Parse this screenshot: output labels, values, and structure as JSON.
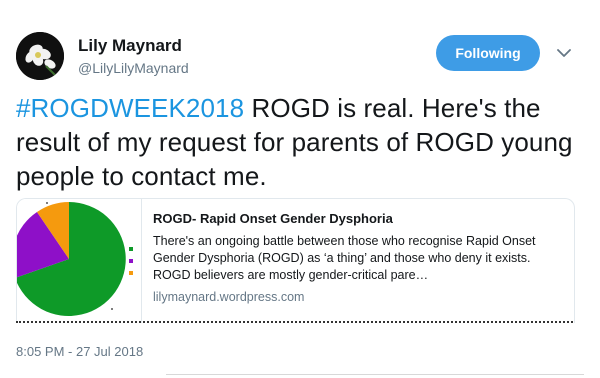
{
  "author": {
    "name": "Lily Maynard",
    "handle": "@LilyLilyMaynard"
  },
  "follow_button": {
    "label": "Following",
    "color": "#3e9ce6"
  },
  "tweet": {
    "hashtag": "#ROGDWEEK2018",
    "text": " ROGD is real. Here's the result of my request for parents of ROGD young people to contact me."
  },
  "card": {
    "title": "ROGD- Rapid Onset Gender Dysphoria",
    "description": "There's an ongoing battle between those who recognise Rapid Onset Gender Dysphoria (ROGD) as ‘a thing’ and those who deny it exists. ROGD believers are mostly gender-critical pare…",
    "url": "lilymaynard.wordpress.com",
    "image": {
      "type": "pie",
      "colors": [
        "#0e9a28",
        "#8e10c8",
        "#f59a0e"
      ]
    }
  },
  "timestamp": "8:05 PM - 27 Jul 2018",
  "colors": {
    "link": "#1b95e0",
    "text": "#14171a",
    "muted": "#657786"
  },
  "icons": {
    "caret": "chevron-down-icon",
    "avatar": "flower-avatar"
  }
}
